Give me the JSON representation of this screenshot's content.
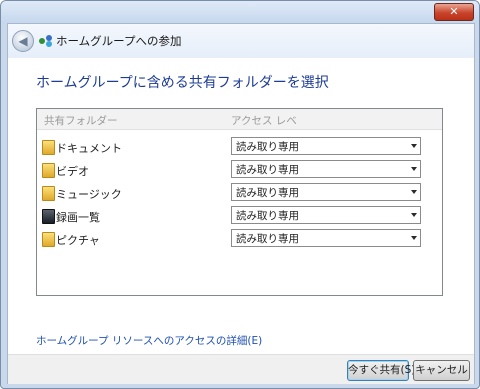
{
  "window": {
    "close_label": "✕"
  },
  "nav": {
    "back_icon": "back-arrow-icon",
    "title": "ホームグループへの参加"
  },
  "heading": "ホームグループに含める共有フォルダーを選択",
  "table": {
    "col_folder": "共有フォルダー",
    "col_access": "アクセス レベ",
    "rows": [
      {
        "label": "ドキュメント",
        "access": "読み取り専用",
        "icon": "documents-folder-icon"
      },
      {
        "label": "ビデオ",
        "access": "読み取り専用",
        "icon": "videos-folder-icon"
      },
      {
        "label": "ミュージック",
        "access": "読み取り専用",
        "icon": "music-folder-icon"
      },
      {
        "label": "録画一覧",
        "access": "読み取り専用",
        "icon": "recorded-tv-folder-icon"
      },
      {
        "label": "ピクチャ",
        "access": "読み取り専用",
        "icon": "pictures-folder-icon"
      }
    ]
  },
  "link": "ホームグループ リソースへのアクセスの詳細(E)",
  "buttons": {
    "share_now": "今すぐ共有(S)",
    "cancel": "キャンセル"
  }
}
